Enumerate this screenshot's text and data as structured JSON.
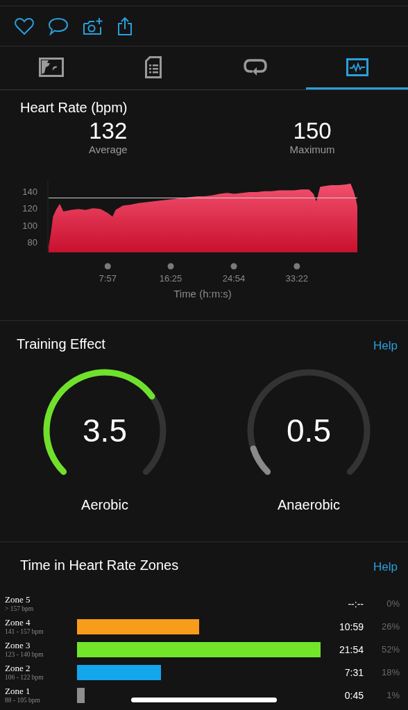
{
  "actions": [
    {
      "kind": "heart"
    },
    {
      "kind": "comment"
    },
    {
      "kind": "camera"
    },
    {
      "kind": "share"
    }
  ],
  "tabs": [
    {
      "kind": "map",
      "selected": false
    },
    {
      "kind": "details",
      "selected": false
    },
    {
      "kind": "laps",
      "selected": false
    },
    {
      "kind": "charts",
      "selected": true
    }
  ],
  "heart_rate": {
    "title": "Heart Rate (bpm)",
    "stats": [
      {
        "value": "132",
        "label": "Average"
      },
      {
        "value": "150",
        "label": "Maximum"
      }
    ],
    "chart_data": {
      "type": "area",
      "xlabel": "Time (h:m:s)",
      "x": [
        0,
        0.3,
        0.6,
        1,
        1.5,
        2,
        3,
        4,
        5,
        6,
        7,
        8,
        8.6,
        9,
        10,
        11,
        12,
        13,
        14,
        15,
        16,
        17,
        18,
        19,
        20,
        21,
        22,
        23,
        24,
        25,
        26,
        27,
        28,
        29,
        30,
        31,
        32,
        33,
        34,
        35,
        35.6,
        36,
        36.5,
        37,
        38,
        39,
        40,
        40.6,
        41,
        41.3,
        41.5
      ],
      "series": [
        {
          "color": "#f2506e",
          "values": [
            75,
            90,
            110,
            118,
            125,
            116,
            118,
            119,
            118,
            120,
            119,
            114,
            110,
            118,
            123,
            124,
            126,
            127,
            128,
            129,
            130,
            131,
            132,
            133,
            134,
            134,
            135,
            137,
            138,
            137,
            138,
            139,
            139,
            140,
            140,
            141,
            141,
            141,
            142,
            142,
            137,
            128,
            145,
            146,
            147,
            147,
            148,
            149,
            140,
            131,
            122
          ]
        }
      ],
      "xlim": [
        0,
        41.5
      ],
      "ylim": [
        68,
        152
      ],
      "yticks": [
        80,
        100,
        120,
        140
      ],
      "xticks": [
        {
          "value": 7.95,
          "label": "7:57"
        },
        {
          "value": 16.42,
          "label": "16:25"
        },
        {
          "value": 24.9,
          "label": "24:54"
        },
        {
          "value": 33.37,
          "label": "33:22"
        }
      ],
      "ref_lines": [
        {
          "axis": "y",
          "value": 132
        }
      ]
    }
  },
  "training_effect": {
    "title": "Training Effect",
    "help": "Help",
    "gauges": [
      {
        "value": "3.5",
        "label": "Aerobic",
        "color": "#6fe12c"
      },
      {
        "value": "0.5",
        "label": "Anaerobic",
        "color": "#8a8a8a"
      }
    ]
  },
  "zones": {
    "title": "Time in Heart Rate Zones",
    "help": "Help",
    "items": [
      {
        "name": "Zone 5",
        "range": "> 157 bpm",
        "time": "--:--",
        "percent": "0%"
      },
      {
        "name": "Zone 4",
        "range": "141 - 157 bpm",
        "color": "#f89c1c",
        "time": "10:59",
        "percent": "26%"
      },
      {
        "name": "Zone 3",
        "range": "123 - 140 bpm",
        "color": "#72e52a",
        "time": "21:54",
        "percent": "52%"
      },
      {
        "name": "Zone 2",
        "range": "106 - 122 bpm",
        "color": "#13a6ec",
        "time": "7:31",
        "percent": "18%"
      },
      {
        "name": "Zone 1",
        "range": "88 - 105 bpm",
        "color": "#8e8e8e",
        "time": "0:45",
        "percent": "1%"
      }
    ]
  }
}
